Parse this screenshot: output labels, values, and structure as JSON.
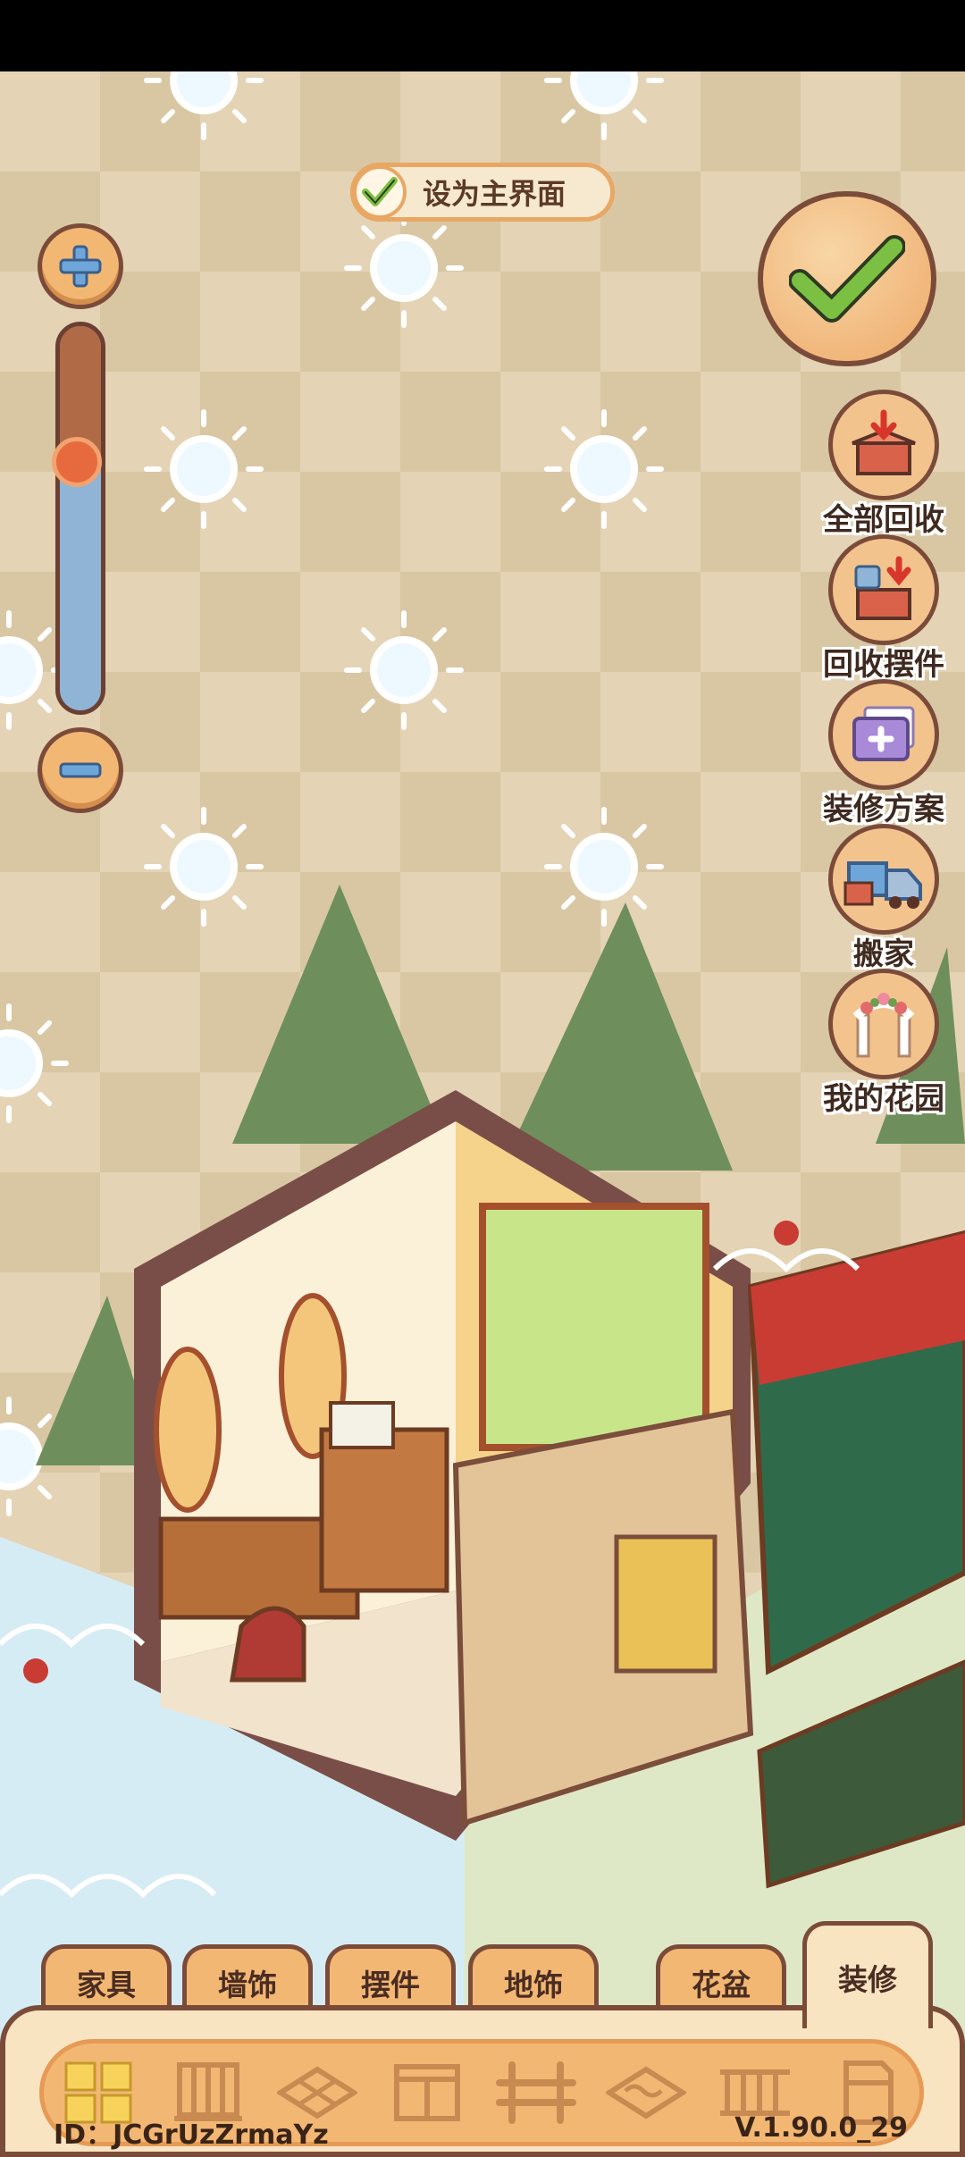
{
  "main_toggle": {
    "label": "设为主界面",
    "checked": true
  },
  "zoom": {
    "level": 0.45,
    "zoom_in_icon": "plus-icon",
    "zoom_out_icon": "minus-icon"
  },
  "confirm": {
    "icon": "checkmark-icon"
  },
  "side_menu": [
    {
      "label": "全部回收",
      "icon": "recycle-all-box-icon"
    },
    {
      "label": "回收摆件",
      "icon": "recycle-ornament-box-icon"
    },
    {
      "label": "装修方案",
      "icon": "decor-plan-folder-icon"
    },
    {
      "label": "搬家",
      "icon": "moving-truck-icon"
    },
    {
      "label": "我的花园",
      "icon": "garden-arch-icon"
    }
  ],
  "tabs": [
    {
      "label": "家具",
      "active": false
    },
    {
      "label": "墙饰",
      "active": false
    },
    {
      "label": "摆件",
      "active": false
    },
    {
      "label": "地饰",
      "active": false
    },
    {
      "label": "花盆",
      "active": false
    },
    {
      "label": "装修",
      "active": true
    }
  ],
  "category_icons": [
    "grid-all-icon",
    "wallpaper-icon",
    "floor-tile-icon",
    "window-icon",
    "fence-icon",
    "floor-pattern-icon",
    "railing-icon",
    "door-icon"
  ],
  "footer": {
    "id_text": "ID：JCGrUzZrmaYz",
    "version": "V.1.90.0_29"
  },
  "colors": {
    "accent": "#f3b774",
    "outline": "#7b4b3a",
    "check_green": "#7cc043",
    "background": "#e4d3b4"
  }
}
